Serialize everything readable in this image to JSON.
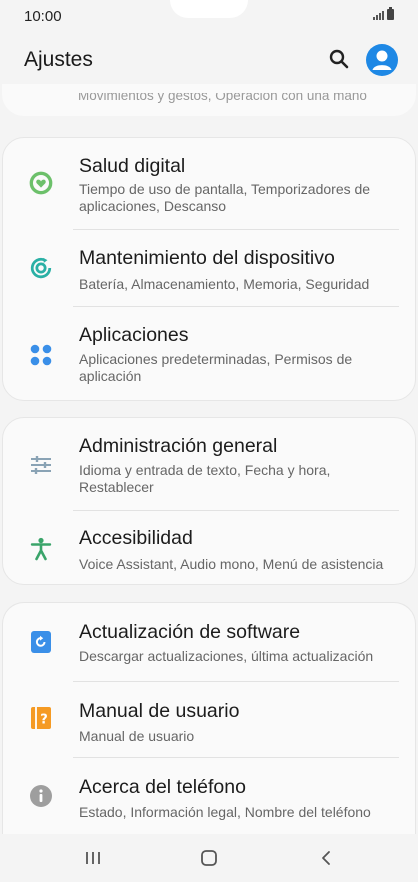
{
  "status": {
    "time": "10:00"
  },
  "header": {
    "title": "Ajustes",
    "search_icon": "search-icon",
    "profile_icon": "avatar"
  },
  "partial": {
    "text": "Movimientos y gestos, Operación con una mano"
  },
  "groups": [
    {
      "items": [
        {
          "title": "Salud digital",
          "subtitle": "Tiempo de uso de pantalla, Temporizadores de aplicaciones, Descanso",
          "icon": "digital-wellbeing-icon",
          "color": "#6cc06a"
        },
        {
          "title": "Mantenimiento del dispositivo",
          "subtitle": "Batería, Almacenamiento, Memoria, Seguridad",
          "icon": "device-care-icon",
          "color": "#2ab0a5"
        },
        {
          "title": "Aplicaciones",
          "subtitle": "Aplicaciones predeterminadas, Permisos de aplicación",
          "icon": "apps-icon",
          "color": "#3a8fe8"
        }
      ]
    },
    {
      "items": [
        {
          "title": "Administración general",
          "subtitle": "Idioma y entrada de texto, Fecha y hora, Restablecer",
          "icon": "sliders-icon",
          "color": "#8aa3b5"
        },
        {
          "title": "Accesibilidad",
          "subtitle": "Voice Assistant, Audio mono, Menú de asistencia",
          "icon": "accessibility-icon",
          "color": "#3aa46a"
        }
      ]
    },
    {
      "items": [
        {
          "title": "Actualización de software",
          "subtitle": "Descargar actualizaciones, última actualización",
          "icon": "software-update-icon",
          "color": "#3a8fe8"
        },
        {
          "title": "Manual de usuario",
          "subtitle": "Manual de usuario",
          "icon": "user-manual-icon",
          "color": "#f59a23"
        },
        {
          "title": "Acerca del teléfono",
          "subtitle": "Estado, Información legal, Nombre del teléfono",
          "icon": "info-icon",
          "color": "#9e9e9e"
        }
      ]
    }
  ],
  "nav": {
    "recents_icon": "recents-icon",
    "home_icon": "home-icon",
    "back_icon": "back-icon"
  }
}
